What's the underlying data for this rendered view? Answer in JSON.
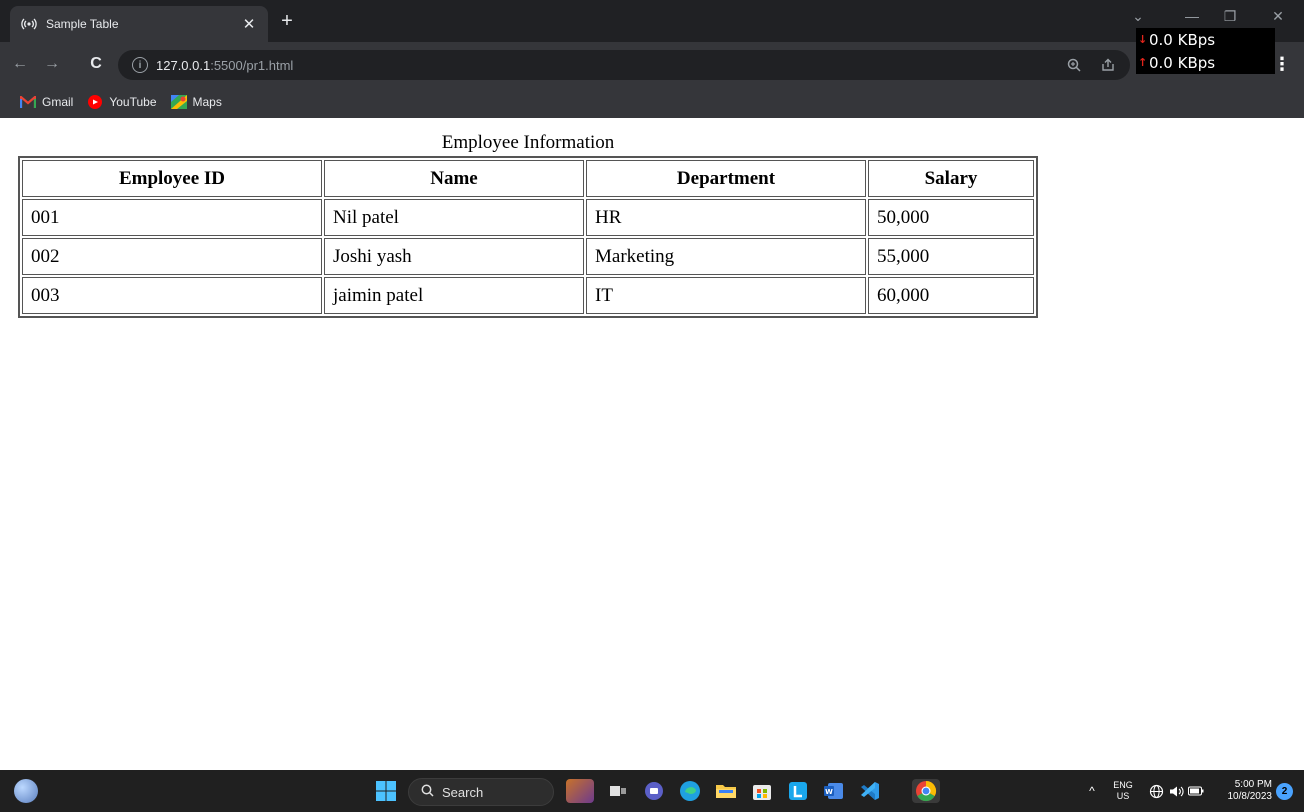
{
  "browser": {
    "tab": {
      "title": "Sample Table"
    },
    "url": {
      "host": "127.0.0.1",
      "rest": ":5500/pr1.html"
    },
    "bookmarks": [
      {
        "label": "Gmail"
      },
      {
        "label": "YouTube"
      },
      {
        "label": "Maps"
      }
    ]
  },
  "net_meter": {
    "down": "0.0 KBps",
    "up": "0.0 KBps"
  },
  "page": {
    "caption": "Employee Information",
    "table": {
      "headers": [
        "Employee ID",
        "Name",
        "Department",
        "Salary"
      ],
      "rows": [
        [
          "001",
          "Nil patel",
          "HR",
          "50,000"
        ],
        [
          "002",
          "Joshi yash",
          "Marketing",
          "55,000"
        ],
        [
          "003",
          "jaimin patel",
          "IT",
          "60,000"
        ]
      ]
    }
  },
  "taskbar": {
    "search_label": "Search",
    "lang": "ENG",
    "region": "US",
    "time": "5:00 PM",
    "date": "10/8/2023",
    "notification_count": "2"
  }
}
